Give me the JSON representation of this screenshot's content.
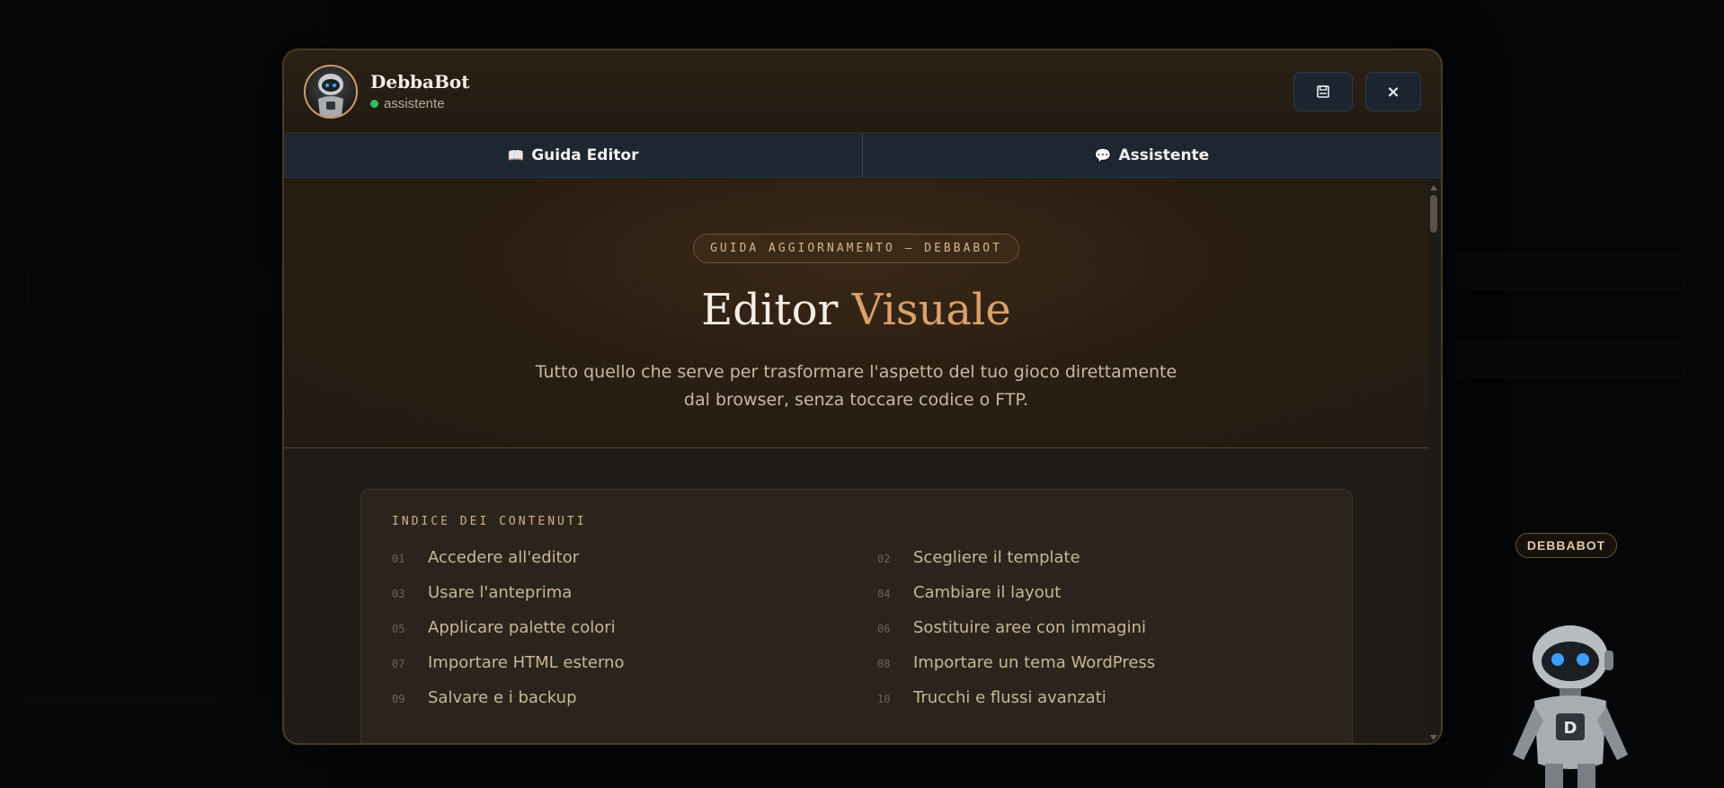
{
  "bot": {
    "name": "DebbaBot",
    "status": "assistente",
    "floating_badge": "DEBBABOT"
  },
  "header": {
    "save_icon": "save-icon",
    "close_label": "×"
  },
  "tabs": [
    {
      "icon": "📖",
      "label": "Guida Editor",
      "active": true
    },
    {
      "icon": "💬",
      "label": "Assistente",
      "active": false
    }
  ],
  "hero": {
    "badge": "GUIDA AGGIORNAMENTO — DEBBABOT",
    "title_main": "Editor",
    "title_accent": "Visuale",
    "subtitle": "Tutto quello che serve per trasformare l'aspetto del tuo gioco direttamente dal browser, senza toccare codice o FTP."
  },
  "toc": {
    "title": "INDICE DEI CONTENUTI",
    "items": [
      {
        "num": "01",
        "label": "Accedere all'editor"
      },
      {
        "num": "02",
        "label": "Scegliere il template"
      },
      {
        "num": "03",
        "label": "Usare l'anteprima"
      },
      {
        "num": "04",
        "label": "Cambiare il layout"
      },
      {
        "num": "05",
        "label": "Applicare palette colori"
      },
      {
        "num": "06",
        "label": "Sostituire aree con immagini"
      },
      {
        "num": "07",
        "label": "Importare HTML esterno"
      },
      {
        "num": "08",
        "label": "Importare un tema WordPress"
      },
      {
        "num": "09",
        "label": "Salvare e i backup"
      },
      {
        "num": "10",
        "label": "Trucchi e flussi avanzati"
      }
    ]
  },
  "colors": {
    "accent": "#d9a06a",
    "modal_border": "#4a3a26",
    "status_online": "#2fbf5a"
  }
}
